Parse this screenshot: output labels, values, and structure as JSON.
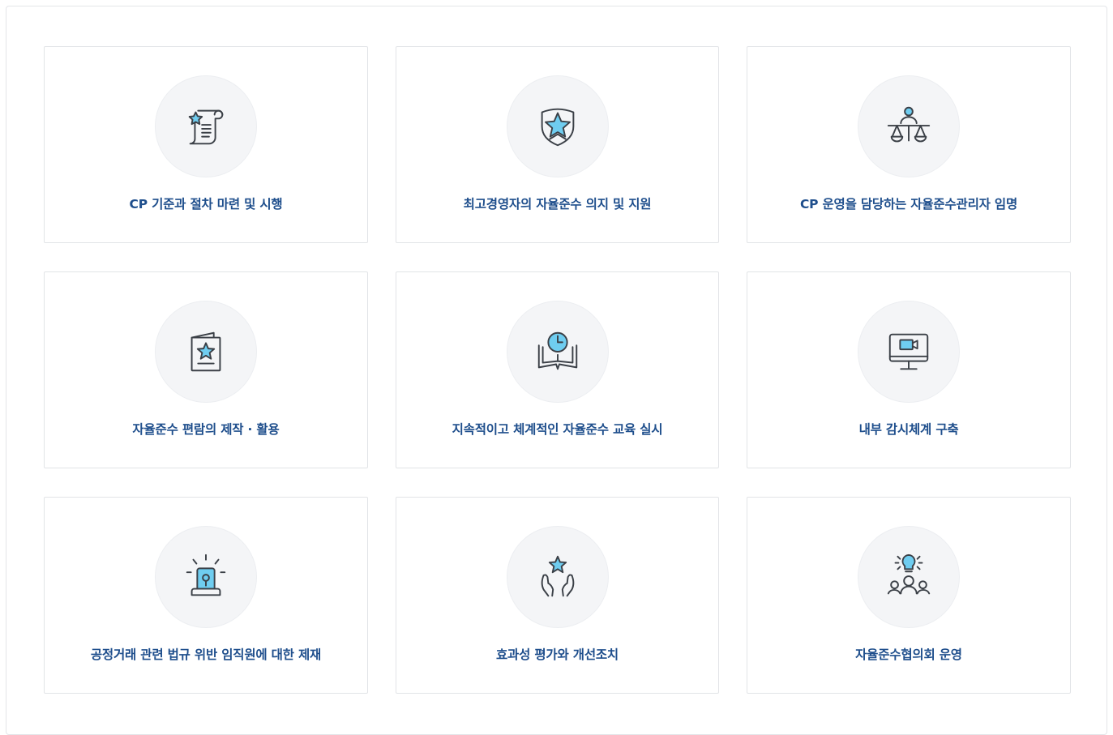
{
  "colors": {
    "label": "#1e4e8c",
    "icon_stroke": "#3b4047",
    "icon_accent": "#6fcdf0",
    "circle_bg": "#f4f5f7",
    "card_border": "#e2e4e7"
  },
  "cards": [
    {
      "label": "CP 기준과 절차 마련 및 시행",
      "icon": "scroll-star-icon"
    },
    {
      "label": "최고경영자의 자율준수 의지 및 지원",
      "icon": "shield-star-icon"
    },
    {
      "label": "CP 운영을 담당하는 자율준수관리자 임명",
      "icon": "person-scales-icon"
    },
    {
      "label": "자율준수 편람의 제작 · 활용",
      "icon": "handbook-star-icon"
    },
    {
      "label": "지속적이고 체계적인 자율준수 교육 실시",
      "icon": "book-clock-icon"
    },
    {
      "label": "내부 감시체계 구축",
      "icon": "monitor-camera-icon"
    },
    {
      "label": "공정거래 관련 법규 위반 임직원에 대한 제재",
      "icon": "siren-icon"
    },
    {
      "label": "효과성 평가와 개선조치",
      "icon": "hands-star-icon"
    },
    {
      "label": "자율준수협의회 운영",
      "icon": "group-idea-icon"
    }
  ]
}
